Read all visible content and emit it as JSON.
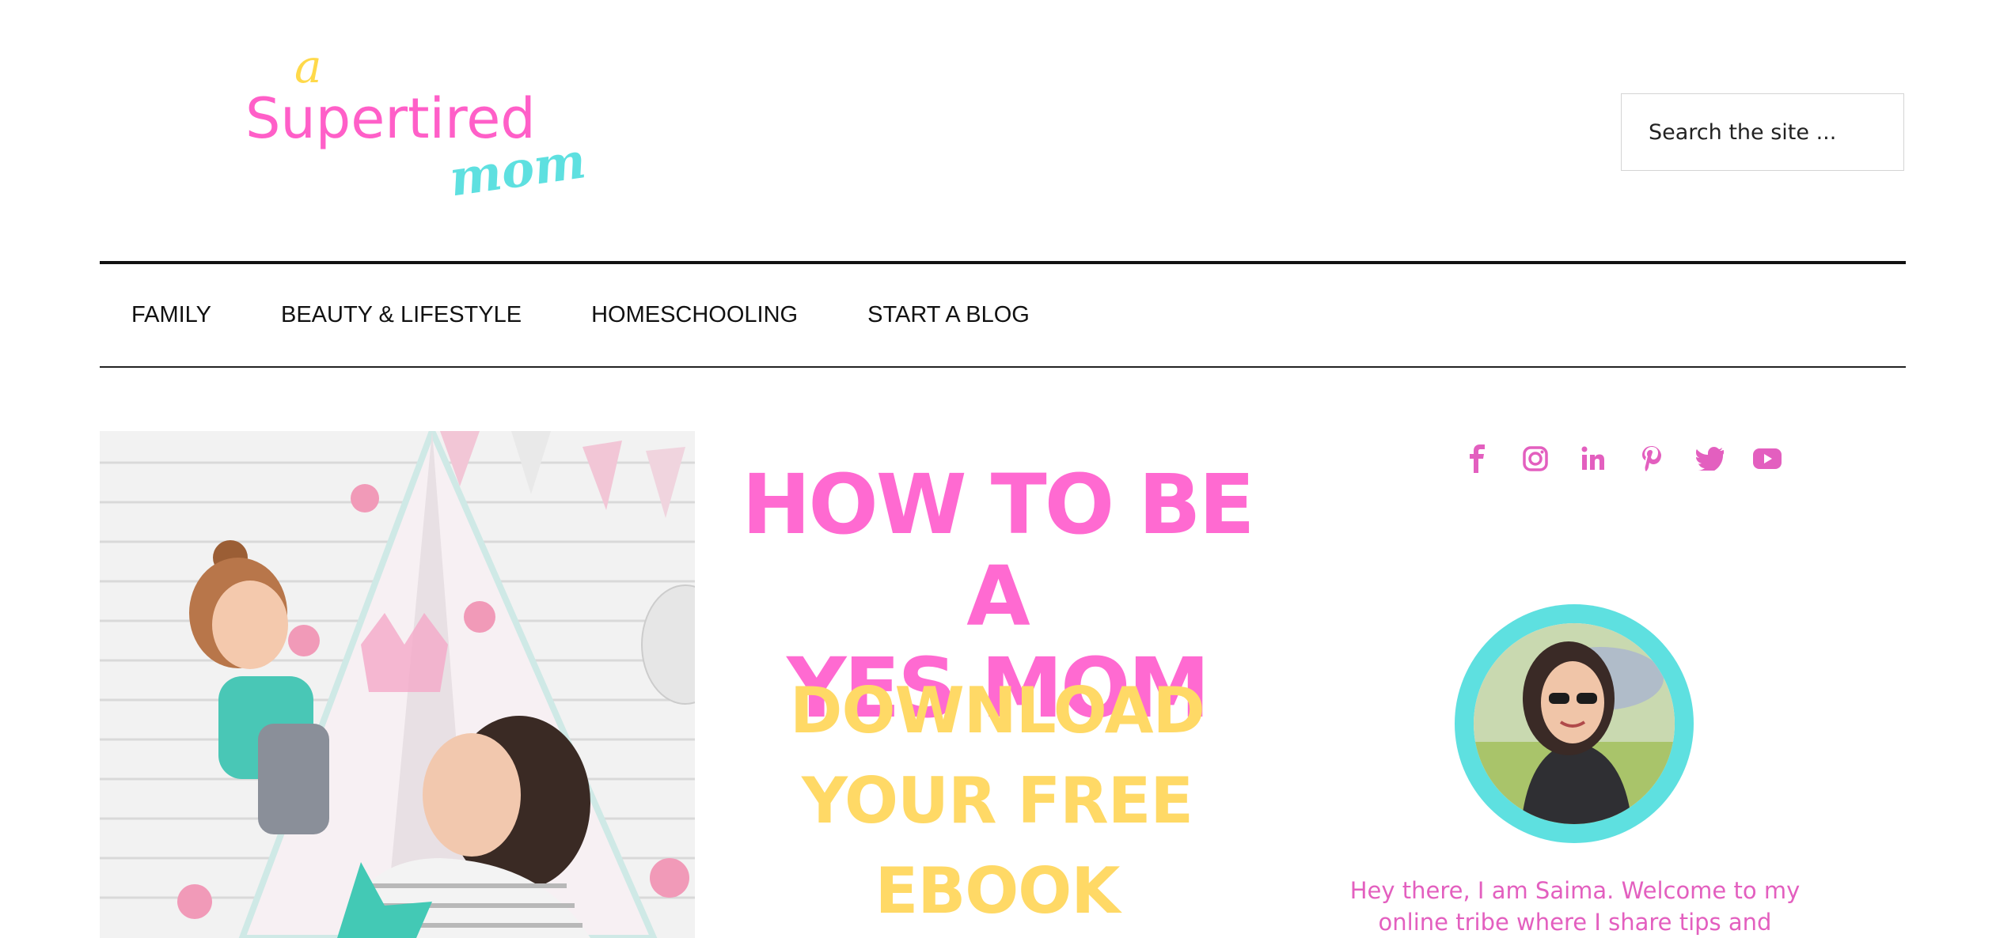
{
  "header": {
    "logo": {
      "line1": "a",
      "line2": "Supertired",
      "line3": "mom",
      "colors": {
        "a": "#ffd94a",
        "supertired": "#ff5fc8",
        "mom": "#5ee0e0"
      }
    },
    "search": {
      "placeholder": "Search the site ..."
    }
  },
  "nav": {
    "items": [
      {
        "label": "FAMILY"
      },
      {
        "label": "BEAUTY & LIFESTYLE"
      },
      {
        "label": "HOMESCHOOLING"
      },
      {
        "label": "START A BLOG"
      }
    ]
  },
  "promo": {
    "title_line1": "HOW TO BE A",
    "title_line2": "YES MOM",
    "sub_line1": "DOWNLOAD",
    "sub_line2": "YOUR FREE",
    "sub_line3": "EBOOK",
    "colors": {
      "title": "#ff6ad1",
      "sub": "#ffd966"
    }
  },
  "sidebar": {
    "social_icons": [
      "facebook-icon",
      "instagram-icon",
      "linkedin-icon",
      "pinterest-icon",
      "twitter-icon",
      "youtube-icon"
    ],
    "icon_color": "#e35fbf",
    "avatar_ring_color": "#5ee0e0",
    "bio_line1": "Hey there, I am Saima. Welcome to my",
    "bio_line2": "online tribe where I share tips and"
  }
}
